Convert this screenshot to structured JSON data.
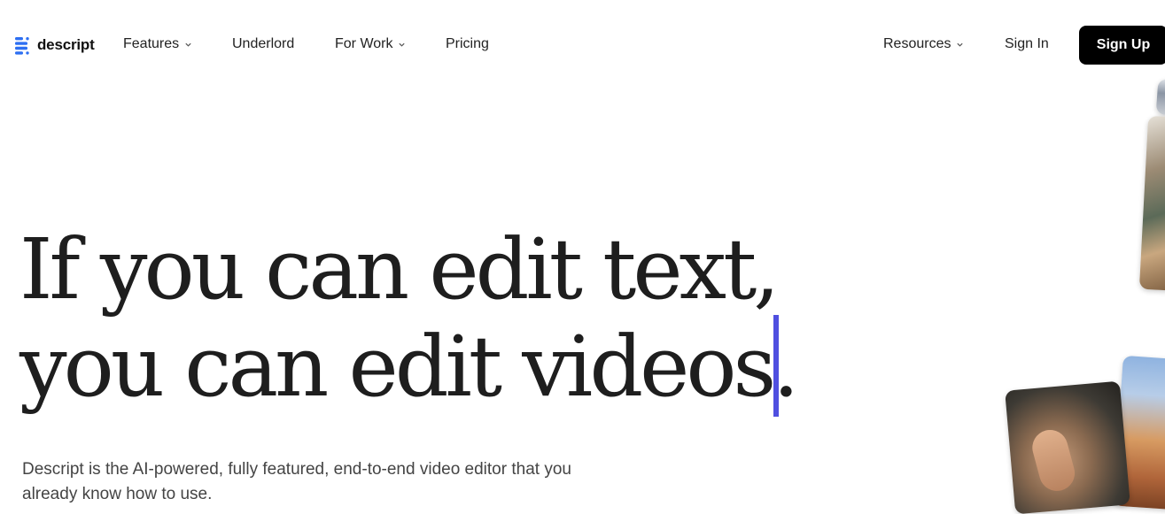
{
  "brand": {
    "name": "descript",
    "accent": "#2d6ff2"
  },
  "nav": {
    "items": [
      {
        "label": "Features",
        "has_dropdown": true
      },
      {
        "label": "Underlord",
        "has_dropdown": false
      },
      {
        "label": "For Work",
        "has_dropdown": true
      },
      {
        "label": "Pricing",
        "has_dropdown": false
      }
    ],
    "resources": {
      "label": "Resources",
      "has_dropdown": true
    },
    "sign_in": "Sign In",
    "sign_up": "Sign Up"
  },
  "hero": {
    "headline_line1": "If you can edit text,",
    "headline_line2": "you can edit videos.",
    "caret_color": "#4f4fe0",
    "subtext": "Descript is the AI-powered, fully featured, end-to-end video editor that you already know how to use."
  }
}
